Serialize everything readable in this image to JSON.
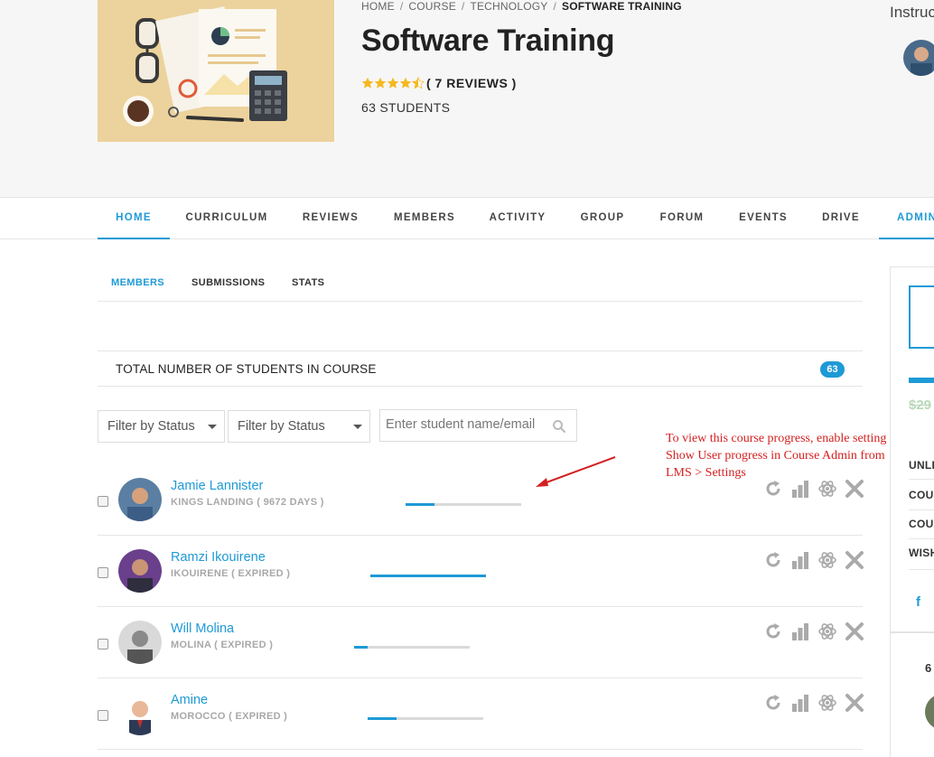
{
  "breadcrumb": {
    "items": [
      "HOME",
      "COURSE",
      "TECHNOLOGY"
    ],
    "current": "SOFTWARE TRAINING"
  },
  "course": {
    "title": "Software Training",
    "rating": 4.5,
    "reviews": "( 7 REVIEWS )",
    "students": "63 STUDENTS"
  },
  "instructor": {
    "label": "Instructor"
  },
  "main_nav": {
    "items": [
      "HOME",
      "CURRICULUM",
      "REVIEWS",
      "MEMBERS",
      "ACTIVITY",
      "GROUP",
      "FORUM",
      "EVENTS",
      "DRIVE",
      "ADMIN"
    ],
    "active": "HOME"
  },
  "sub_nav": {
    "items": [
      "MEMBERS",
      "SUBMISSIONS",
      "STATS"
    ],
    "active": "MEMBERS"
  },
  "total": {
    "label": "TOTAL NUMBER OF STUDENTS IN COURSE",
    "count": "63"
  },
  "filters": {
    "status1": "Filter by Status",
    "status2": "Filter by Status",
    "search_placeholder": "Enter student name/email"
  },
  "note": {
    "line1": "To view this course progress, enable setting",
    "line2": "Show User progress in Course Admin from",
    "line3": "LMS > Settings"
  },
  "members": [
    {
      "name": "Jamie Lannister",
      "meta": "KINGS LANDING ( 9672 DAYS )",
      "progress": 0.25
    },
    {
      "name": "Ramzi Ikouirene",
      "meta": "IKOUIRENE ( EXPIRED )",
      "progress": 1.0
    },
    {
      "name": "Will Molina",
      "meta": "MOLINA ( EXPIRED )",
      "progress": 0.12
    },
    {
      "name": "Amine",
      "meta": "MOROCCO ( EXPIRED )",
      "progress": 0.25
    }
  ],
  "sidebar": {
    "price": "$29",
    "items": [
      "UNLI",
      "COU",
      "COU",
      "WISH"
    ],
    "count": "6"
  },
  "colors": {
    "accent": "#1e9ad6",
    "note": "#d42020",
    "header_bg": "#f6f6f6",
    "thumb_bg": "#ecd29c"
  },
  "icons": {
    "member_actions": [
      "reset-icon",
      "stats-icon",
      "atom-icon",
      "remove-icon"
    ],
    "search": "search-icon",
    "facebook": "facebook-icon"
  }
}
